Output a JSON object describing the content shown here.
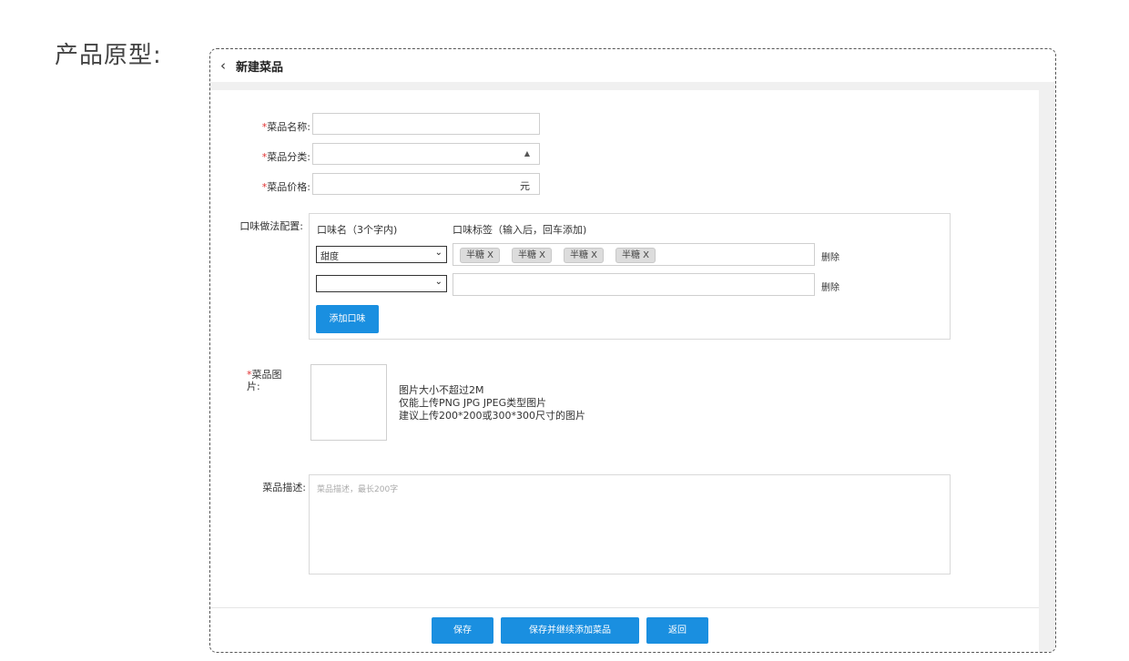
{
  "page_heading": "产品原型:",
  "header": {
    "back_icon": "‹",
    "title": "新建菜品"
  },
  "form": {
    "name_label": "菜品名称:",
    "category_label": "菜品分类:",
    "price_label": "菜品价格:",
    "price_unit": "元",
    "required_mark": "*",
    "flavor_label": "口味做法配置:",
    "flavor_col_name": "口味名（3个字内)",
    "flavor_col_tags": "口味标签（输入后，回车添加)",
    "flavor_rows": [
      {
        "name": "甜度",
        "tags": [
          "半糖 X",
          "半糖 X",
          "半糖 X",
          "半糖 X"
        ],
        "delete_label": "删除"
      },
      {
        "name": "",
        "tags": [],
        "delete_label": "删除"
      }
    ],
    "add_flavor_button": "添加口味",
    "image_label_line1": "菜品图",
    "image_label_line2": "片:",
    "image_hints": [
      "图片大小不超过2M",
      "仅能上传PNG JPG JPEG类型图片",
      "建议上传200*200或300*300尺寸的图片"
    ],
    "desc_label": "菜品描述:",
    "desc_placeholder": "菜品描述，最长200字"
  },
  "footer": {
    "save_button": "保存",
    "save_continue_button": "保存并继续添加菜品",
    "back_button": "返回"
  },
  "colors": {
    "primary": "#1a8fe0",
    "required": "#e03030"
  }
}
